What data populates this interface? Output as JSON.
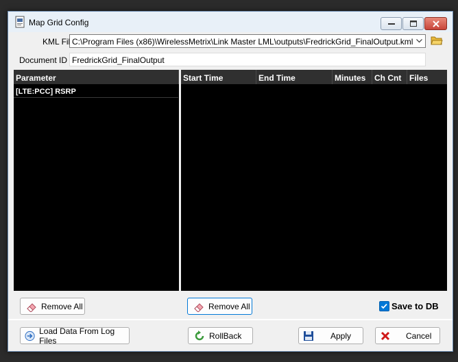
{
  "window": {
    "title": "Map Grid Config"
  },
  "form": {
    "kml_label": "KML File:",
    "kml_value": "C:\\Program Files (x86)\\WirelessMetrix\\Link Master LML\\outputs\\FredrickGrid_FinalOutput.kml",
    "doc_label": "Document ID",
    "doc_value": "FredrickGrid_FinalOutput"
  },
  "param_table": {
    "header": "Parameter",
    "rows": [
      "[LTE:PCC] RSRP"
    ]
  },
  "log_table": {
    "columns": [
      "Start Time",
      "End Time",
      "Minutes",
      "Ch Cnt",
      "Files"
    ]
  },
  "buttons": {
    "remove_all_left": "Remove All",
    "remove_all_right": "Remove All",
    "save_to_db": "Save to DB",
    "load_data": "Load Data From Log Files",
    "rollback": "RollBack",
    "apply": "Apply",
    "cancel": "Cancel"
  },
  "state": {
    "save_to_db_checked": true
  },
  "colors": {
    "panel_bg": "#000000",
    "header_bg": "#303030",
    "accent": "#0078d7"
  }
}
